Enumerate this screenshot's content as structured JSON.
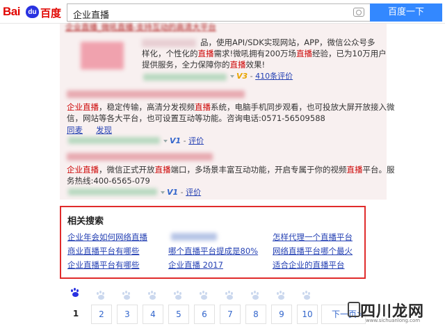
{
  "header": {
    "logo": {
      "latin": "Bai",
      "paw": "du",
      "chinese": "百度"
    },
    "query": "企业直播",
    "search_button": "百度一下"
  },
  "results": [
    {
      "title": "企业直播_微吼直播-支持互动的高清大平台",
      "desc_lines": [
        [
          {
            "t": "品，使用API/SDK实现网站，APP，微信公众号多"
          }
        ],
        [
          {
            "t": "样化，个性化的"
          },
          {
            "t": "直播",
            "h": true
          },
          {
            "t": "需求!微吼拥有200万场"
          },
          {
            "t": "直播",
            "h": true
          },
          {
            "t": "经验，已为10万用户"
          }
        ],
        [
          {
            "t": "提供服务，全力保障你的"
          },
          {
            "t": "直播",
            "h": true
          },
          {
            "t": "效果!"
          }
        ]
      ],
      "badge": "V3",
      "reviews": "410条评价"
    },
    {
      "desc_lines": [
        [
          {
            "t": "企业直播",
            "h": true
          },
          {
            "t": "，稳定传输，高清分发视频"
          },
          {
            "t": "直播",
            "h": true
          },
          {
            "t": "系统，电脑手机同步观看，也可投放大屏开放接入微"
          }
        ],
        [
          {
            "t": "信，网站等各大平台，也可设置互动等功能。咨询电话:0571-56509588"
          }
        ]
      ],
      "links": [
        "同麦",
        "发现"
      ],
      "badge": "V1",
      "reviews": "评价"
    },
    {
      "desc_lines": [
        [
          {
            "t": "企业直播",
            "h": true
          },
          {
            "t": "，微信正式开放"
          },
          {
            "t": "直播",
            "h": true
          },
          {
            "t": "端口，多场景丰富互动功能，开启专属于你的视频"
          },
          {
            "t": "直播",
            "h": true
          },
          {
            "t": "平台。服"
          }
        ],
        [
          {
            "t": "务热线:400-6565-079"
          }
        ]
      ],
      "badge": "V1",
      "reviews": "评价"
    }
  ],
  "related": {
    "title": "相关搜索",
    "items": [
      "企业年会如何网络直播",
      "",
      "怎样代理一个直播平台",
      "商业直播平台有哪些",
      "哪个直播平台提成是80%",
      "网络直播平台哪个最火",
      "企业直播平台有哪些",
      "企业直播 2017",
      "适合企业的直播平台"
    ]
  },
  "pager": {
    "pages": [
      "1",
      "2",
      "3",
      "4",
      "5",
      "6",
      "7",
      "8",
      "9",
      "10"
    ],
    "current": "1",
    "next": "下一页>"
  },
  "watermark": {
    "text": "四川龙网",
    "url": "www.sichuanlong.com"
  },
  "colors": {
    "accent": "#3388ff",
    "highlight": "#cc0000",
    "link": "#2440b3",
    "border_red": "#e02b2b",
    "logo_red": "#e10602",
    "logo_blue": "#2932e1"
  },
  "icons": {
    "camera": "camera-icon",
    "paw": "baidu-paw-icon"
  }
}
